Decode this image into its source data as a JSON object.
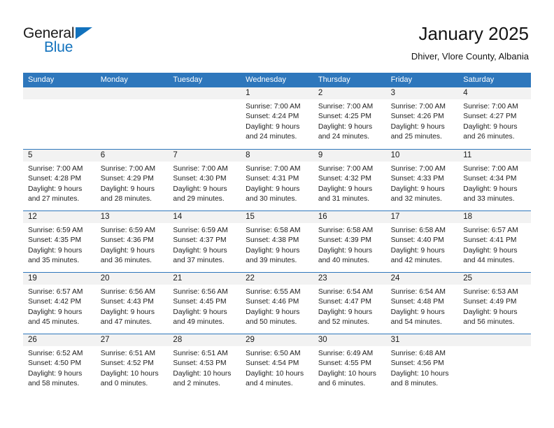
{
  "brand": {
    "name_top": "General",
    "name_bottom": "Blue",
    "accent_color": "#1272bd"
  },
  "header": {
    "title": "January 2025",
    "subtitle": "Dhiver, Vlore County, Albania"
  },
  "theme": {
    "header_blue": "#2e77bc",
    "day_band_gray": "#f2f2f2",
    "text": "#1a1a1a"
  },
  "weekdays": [
    "Sunday",
    "Monday",
    "Tuesday",
    "Wednesday",
    "Thursday",
    "Friday",
    "Saturday"
  ],
  "labels": {
    "sunrise_prefix": "Sunrise:",
    "sunset_prefix": "Sunset:",
    "daylight_prefix": "Daylight:"
  },
  "weeks": [
    [
      {
        "day": "",
        "empty": true
      },
      {
        "day": "",
        "empty": true
      },
      {
        "day": "",
        "empty": true
      },
      {
        "day": "1",
        "sunrise": "Sunrise: 7:00 AM",
        "sunset": "Sunset: 4:24 PM",
        "daylight1": "Daylight: 9 hours",
        "daylight2": "and 24 minutes."
      },
      {
        "day": "2",
        "sunrise": "Sunrise: 7:00 AM",
        "sunset": "Sunset: 4:25 PM",
        "daylight1": "Daylight: 9 hours",
        "daylight2": "and 24 minutes."
      },
      {
        "day": "3",
        "sunrise": "Sunrise: 7:00 AM",
        "sunset": "Sunset: 4:26 PM",
        "daylight1": "Daylight: 9 hours",
        "daylight2": "and 25 minutes."
      },
      {
        "day": "4",
        "sunrise": "Sunrise: 7:00 AM",
        "sunset": "Sunset: 4:27 PM",
        "daylight1": "Daylight: 9 hours",
        "daylight2": "and 26 minutes."
      }
    ],
    [
      {
        "day": "5",
        "sunrise": "Sunrise: 7:00 AM",
        "sunset": "Sunset: 4:28 PM",
        "daylight1": "Daylight: 9 hours",
        "daylight2": "and 27 minutes."
      },
      {
        "day": "6",
        "sunrise": "Sunrise: 7:00 AM",
        "sunset": "Sunset: 4:29 PM",
        "daylight1": "Daylight: 9 hours",
        "daylight2": "and 28 minutes."
      },
      {
        "day": "7",
        "sunrise": "Sunrise: 7:00 AM",
        "sunset": "Sunset: 4:30 PM",
        "daylight1": "Daylight: 9 hours",
        "daylight2": "and 29 minutes."
      },
      {
        "day": "8",
        "sunrise": "Sunrise: 7:00 AM",
        "sunset": "Sunset: 4:31 PM",
        "daylight1": "Daylight: 9 hours",
        "daylight2": "and 30 minutes."
      },
      {
        "day": "9",
        "sunrise": "Sunrise: 7:00 AM",
        "sunset": "Sunset: 4:32 PM",
        "daylight1": "Daylight: 9 hours",
        "daylight2": "and 31 minutes."
      },
      {
        "day": "10",
        "sunrise": "Sunrise: 7:00 AM",
        "sunset": "Sunset: 4:33 PM",
        "daylight1": "Daylight: 9 hours",
        "daylight2": "and 32 minutes."
      },
      {
        "day": "11",
        "sunrise": "Sunrise: 7:00 AM",
        "sunset": "Sunset: 4:34 PM",
        "daylight1": "Daylight: 9 hours",
        "daylight2": "and 33 minutes."
      }
    ],
    [
      {
        "day": "12",
        "sunrise": "Sunrise: 6:59 AM",
        "sunset": "Sunset: 4:35 PM",
        "daylight1": "Daylight: 9 hours",
        "daylight2": "and 35 minutes."
      },
      {
        "day": "13",
        "sunrise": "Sunrise: 6:59 AM",
        "sunset": "Sunset: 4:36 PM",
        "daylight1": "Daylight: 9 hours",
        "daylight2": "and 36 minutes."
      },
      {
        "day": "14",
        "sunrise": "Sunrise: 6:59 AM",
        "sunset": "Sunset: 4:37 PM",
        "daylight1": "Daylight: 9 hours",
        "daylight2": "and 37 minutes."
      },
      {
        "day": "15",
        "sunrise": "Sunrise: 6:58 AM",
        "sunset": "Sunset: 4:38 PM",
        "daylight1": "Daylight: 9 hours",
        "daylight2": "and 39 minutes."
      },
      {
        "day": "16",
        "sunrise": "Sunrise: 6:58 AM",
        "sunset": "Sunset: 4:39 PM",
        "daylight1": "Daylight: 9 hours",
        "daylight2": "and 40 minutes."
      },
      {
        "day": "17",
        "sunrise": "Sunrise: 6:58 AM",
        "sunset": "Sunset: 4:40 PM",
        "daylight1": "Daylight: 9 hours",
        "daylight2": "and 42 minutes."
      },
      {
        "day": "18",
        "sunrise": "Sunrise: 6:57 AM",
        "sunset": "Sunset: 4:41 PM",
        "daylight1": "Daylight: 9 hours",
        "daylight2": "and 44 minutes."
      }
    ],
    [
      {
        "day": "19",
        "sunrise": "Sunrise: 6:57 AM",
        "sunset": "Sunset: 4:42 PM",
        "daylight1": "Daylight: 9 hours",
        "daylight2": "and 45 minutes."
      },
      {
        "day": "20",
        "sunrise": "Sunrise: 6:56 AM",
        "sunset": "Sunset: 4:43 PM",
        "daylight1": "Daylight: 9 hours",
        "daylight2": "and 47 minutes."
      },
      {
        "day": "21",
        "sunrise": "Sunrise: 6:56 AM",
        "sunset": "Sunset: 4:45 PM",
        "daylight1": "Daylight: 9 hours",
        "daylight2": "and 49 minutes."
      },
      {
        "day": "22",
        "sunrise": "Sunrise: 6:55 AM",
        "sunset": "Sunset: 4:46 PM",
        "daylight1": "Daylight: 9 hours",
        "daylight2": "and 50 minutes."
      },
      {
        "day": "23",
        "sunrise": "Sunrise: 6:54 AM",
        "sunset": "Sunset: 4:47 PM",
        "daylight1": "Daylight: 9 hours",
        "daylight2": "and 52 minutes."
      },
      {
        "day": "24",
        "sunrise": "Sunrise: 6:54 AM",
        "sunset": "Sunset: 4:48 PM",
        "daylight1": "Daylight: 9 hours",
        "daylight2": "and 54 minutes."
      },
      {
        "day": "25",
        "sunrise": "Sunrise: 6:53 AM",
        "sunset": "Sunset: 4:49 PM",
        "daylight1": "Daylight: 9 hours",
        "daylight2": "and 56 minutes."
      }
    ],
    [
      {
        "day": "26",
        "sunrise": "Sunrise: 6:52 AM",
        "sunset": "Sunset: 4:50 PM",
        "daylight1": "Daylight: 9 hours",
        "daylight2": "and 58 minutes."
      },
      {
        "day": "27",
        "sunrise": "Sunrise: 6:51 AM",
        "sunset": "Sunset: 4:52 PM",
        "daylight1": "Daylight: 10 hours",
        "daylight2": "and 0 minutes."
      },
      {
        "day": "28",
        "sunrise": "Sunrise: 6:51 AM",
        "sunset": "Sunset: 4:53 PM",
        "daylight1": "Daylight: 10 hours",
        "daylight2": "and 2 minutes."
      },
      {
        "day": "29",
        "sunrise": "Sunrise: 6:50 AM",
        "sunset": "Sunset: 4:54 PM",
        "daylight1": "Daylight: 10 hours",
        "daylight2": "and 4 minutes."
      },
      {
        "day": "30",
        "sunrise": "Sunrise: 6:49 AM",
        "sunset": "Sunset: 4:55 PM",
        "daylight1": "Daylight: 10 hours",
        "daylight2": "and 6 minutes."
      },
      {
        "day": "31",
        "sunrise": "Sunrise: 6:48 AM",
        "sunset": "Sunset: 4:56 PM",
        "daylight1": "Daylight: 10 hours",
        "daylight2": "and 8 minutes."
      },
      {
        "day": "",
        "empty": true
      }
    ]
  ]
}
